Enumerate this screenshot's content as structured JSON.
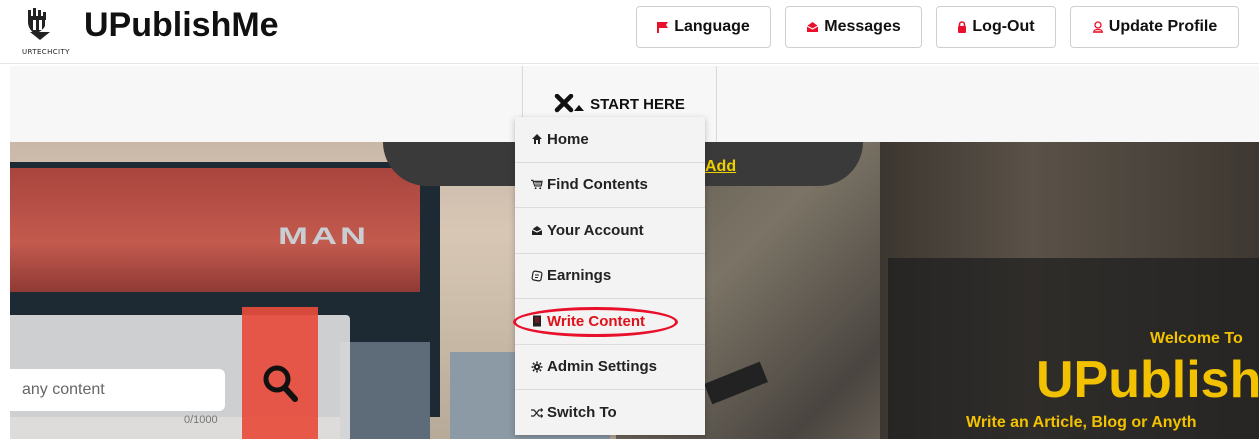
{
  "header": {
    "logo_text": "URTECHCITY",
    "app_title": "UPublishMe",
    "buttons": [
      {
        "label": "Language",
        "icon": "flag-icon"
      },
      {
        "label": "Messages",
        "icon": "message-icon"
      },
      {
        "label": "Log-Out",
        "icon": "lock-icon"
      },
      {
        "label": "Update Profile",
        "icon": "user-icon"
      }
    ]
  },
  "nav": {
    "start_here_label": "START HERE"
  },
  "menu": {
    "items": [
      {
        "label": "Home",
        "icon": "home-icon"
      },
      {
        "label": "Find Contents",
        "icon": "cart-icon"
      },
      {
        "label": "Your Account",
        "icon": "account-icon"
      },
      {
        "label": "Earnings",
        "icon": "earnings-icon"
      },
      {
        "label": "Write Content",
        "icon": "document-icon"
      },
      {
        "label": "Admin Settings",
        "icon": "gear-icon"
      },
      {
        "label": "Switch To",
        "icon": "shuffle-icon"
      }
    ]
  },
  "hero": {
    "add_link": "Add",
    "bus_brand": "MAN",
    "welcome_small": "Welcome To",
    "welcome_big": "UPublish",
    "welcome_sub": "Write an Article, Blog or Anyth"
  },
  "search": {
    "placeholder": "any content",
    "count": "0/1000"
  },
  "colors": {
    "accent_red": "#e8102a",
    "highlight_yellow": "#f2c200"
  }
}
